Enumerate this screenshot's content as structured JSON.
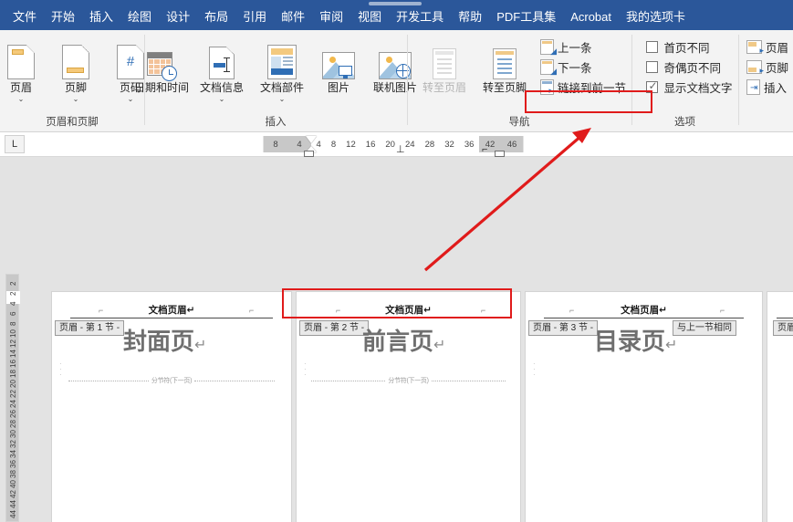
{
  "app": {
    "menu_tabs": [
      {
        "label": "文件",
        "selected": false
      },
      {
        "label": "开始",
        "selected": false
      },
      {
        "label": "插入",
        "selected": false
      },
      {
        "label": "绘图",
        "selected": false
      },
      {
        "label": "设计",
        "selected": false
      },
      {
        "label": "布局",
        "selected": false
      },
      {
        "label": "引用",
        "selected": false
      },
      {
        "label": "邮件",
        "selected": false
      },
      {
        "label": "审阅",
        "selected": false
      },
      {
        "label": "视图",
        "selected": false
      },
      {
        "label": "开发工具",
        "selected": false
      },
      {
        "label": "帮助",
        "selected": false
      },
      {
        "label": "PDF工具集",
        "selected": false
      },
      {
        "label": "Acrobat",
        "selected": false
      },
      {
        "label": "我的选项卡",
        "selected": false
      }
    ],
    "accent_color": "#2b579a",
    "highlight_color": "#e01b1b"
  },
  "ribbon": {
    "groups": [
      {
        "name": "header-footer-group",
        "title": "页眉和页脚",
        "buttons": [
          {
            "label": "页眉",
            "icon": "header-page-icon",
            "has_caret": true,
            "disabled": false
          },
          {
            "label": "页脚",
            "icon": "footer-page-icon",
            "has_caret": true,
            "disabled": false
          },
          {
            "label": "页码",
            "icon": "page-number-icon",
            "has_caret": true,
            "disabled": false
          }
        ]
      },
      {
        "name": "insert-group",
        "title": "插入",
        "buttons": [
          {
            "label": "日期和时间",
            "icon": "date-time-icon",
            "has_caret": false,
            "disabled": false
          },
          {
            "label": "文档信息",
            "icon": "document-info-icon",
            "has_caret": true,
            "disabled": false
          },
          {
            "label": "文档部件",
            "icon": "document-parts-icon",
            "has_caret": true,
            "disabled": false
          },
          {
            "label": "图片",
            "icon": "picture-icon",
            "has_caret": false,
            "disabled": false
          },
          {
            "label": "联机图片",
            "icon": "online-picture-icon",
            "has_caret": false,
            "disabled": false
          }
        ]
      },
      {
        "name": "navigation-group",
        "title": "导航",
        "buttons": [
          {
            "label": "转至页眉",
            "icon": "goto-header-icon",
            "disabled": true
          },
          {
            "label": "转至页脚",
            "icon": "goto-footer-icon",
            "disabled": false
          }
        ],
        "small_buttons": [
          {
            "label": "上一条",
            "icon": "previous-record-icon",
            "highlighted": false
          },
          {
            "label": "下一条",
            "icon": "next-record-icon",
            "highlighted": false
          },
          {
            "label": "链接到前一节",
            "icon": "link-to-previous-icon",
            "highlighted": true
          }
        ]
      },
      {
        "name": "options-group",
        "title": "选项",
        "options": [
          {
            "label": "首页不同",
            "checked": false
          },
          {
            "label": "奇偶页不同",
            "checked": false
          },
          {
            "label": "显示文档文字",
            "checked": true
          }
        ]
      },
      {
        "name": "position-group",
        "title": "",
        "items": [
          {
            "label": "页眉",
            "icon": "header-position-icon"
          },
          {
            "label": "页脚",
            "icon": "footer-position-icon"
          },
          {
            "label": "插入",
            "icon": "insert-alignment-tab-icon"
          }
        ]
      }
    ]
  },
  "ruler": {
    "tabstop_label": "L",
    "left_margin_numbers": [
      "8",
      "4"
    ],
    "page_numbers": [
      "4",
      "8",
      "12",
      "16",
      "20",
      "24",
      "28",
      "32",
      "36"
    ],
    "right_margin_numbers": [
      "42",
      "46"
    ],
    "vertical_numbers": [
      "2",
      "2",
      "4",
      "6",
      "8",
      "10",
      "12",
      "14",
      "16",
      "18",
      "20",
      "22",
      "24",
      "26",
      "28",
      "30",
      "32",
      "34",
      "36",
      "38",
      "40",
      "42",
      "44",
      "44"
    ]
  },
  "document": {
    "pages": [
      {
        "name": "page-1",
        "header_title": "文档页眉↵",
        "header_tag": "页眉 - 第 1 节 -",
        "same_as_previous_tag": "",
        "body_text": "封面页",
        "pilcrow": "↵",
        "section_break_text": "分节符(下一页)"
      },
      {
        "name": "page-2",
        "header_title": "文档页眉↵",
        "header_tag": "页眉 - 第 2 节 -",
        "same_as_previous_tag": "",
        "body_text": "前言页",
        "pilcrow": "↵",
        "section_break_text": "分节符(下一页)"
      },
      {
        "name": "page-3",
        "header_title": "文档页眉↵",
        "header_tag": "页眉 - 第 3 节 -",
        "same_as_previous_tag": "与上一节相同",
        "body_text": "目录页",
        "pilcrow": "↵",
        "section_break_text": ""
      },
      {
        "name": "page-4",
        "header_title": "",
        "header_tag": "页眉",
        "same_as_previous_tag": "",
        "body_text": "",
        "pilcrow": "",
        "section_break_text": ""
      }
    ]
  },
  "annotations": {
    "ribbon_highlight_label": "链接到前一节",
    "page_highlight_label": "文档页眉",
    "arrow_label": "arrow-pointing-to-link-to-previous"
  }
}
